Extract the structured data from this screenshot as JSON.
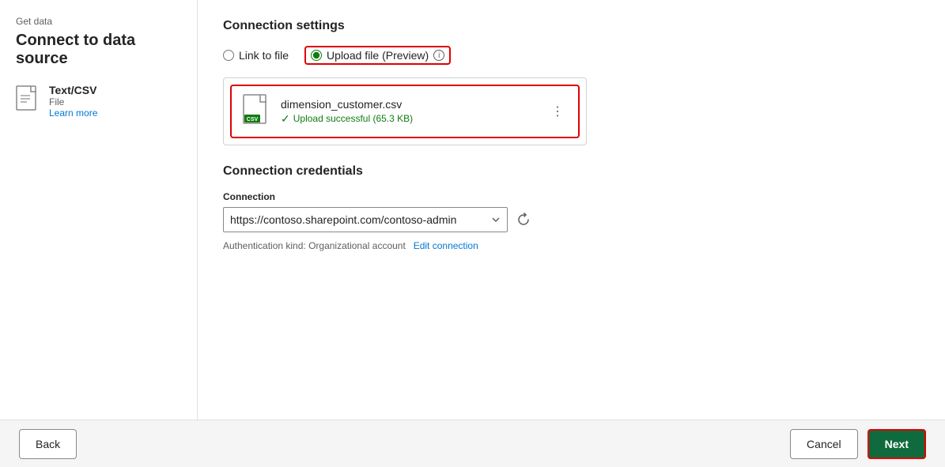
{
  "breadcrumb": "Get data",
  "page_title": "Connect to data source",
  "sidebar": {
    "item_name": "Text/CSV",
    "item_type": "File",
    "learn_more": "Learn more"
  },
  "connection_settings": {
    "section_title": "Connection settings",
    "radio_link": "Link to file",
    "radio_upload": "Upload file (Preview)",
    "info_icon_label": "i",
    "file": {
      "name": "dimension_customer.csv",
      "status": "Upload successful (65.3 KB)",
      "menu_icon": "⋮"
    }
  },
  "connection_credentials": {
    "section_title": "Connection credentials",
    "connection_label": "Connection",
    "connection_value": "https://contoso.sharepoint.com/contoso-admin",
    "auth_text": "Authentication kind: Organizational account",
    "edit_link": "Edit connection"
  },
  "footer": {
    "back_label": "Back",
    "cancel_label": "Cancel",
    "next_label": "Next"
  }
}
